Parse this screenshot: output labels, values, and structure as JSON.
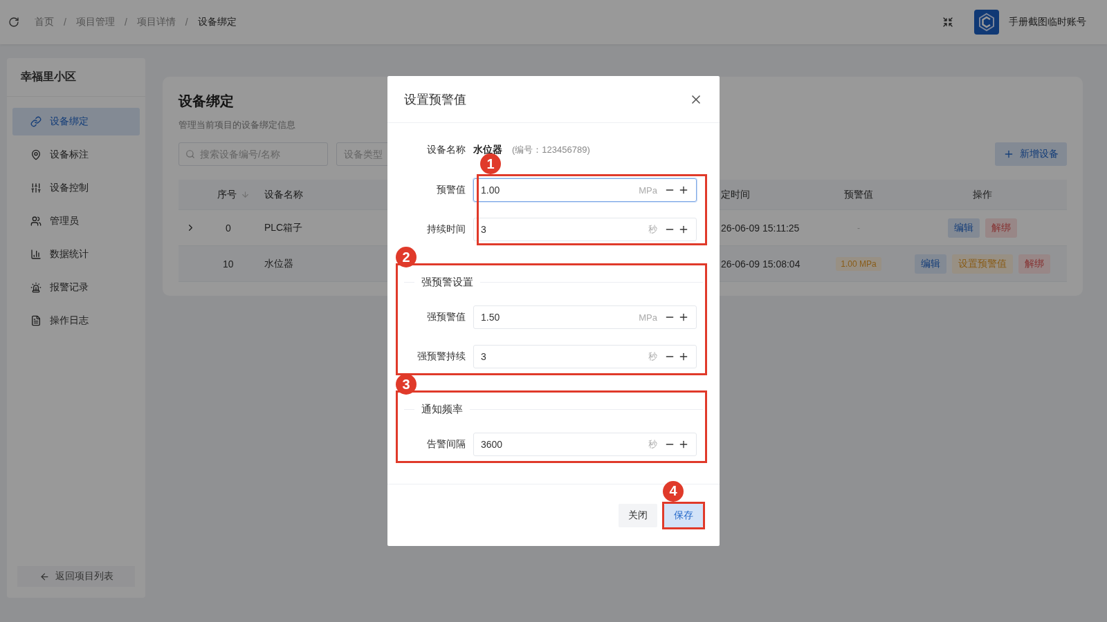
{
  "header": {
    "breadcrumb": [
      {
        "label": "首页",
        "current": false
      },
      {
        "label": "项目管理",
        "current": false
      },
      {
        "label": "项目详情",
        "current": false
      },
      {
        "label": "设备绑定",
        "current": true
      }
    ],
    "separator": "/",
    "user": "手册截图临时账号"
  },
  "sidebar": {
    "title": "幸福里小区",
    "items": [
      {
        "label": "设备绑定",
        "selected": true
      },
      {
        "label": "设备标注",
        "selected": false
      },
      {
        "label": "设备控制",
        "selected": false
      },
      {
        "label": "管理员",
        "selected": false
      },
      {
        "label": "数据统计",
        "selected": false
      },
      {
        "label": "报警记录",
        "selected": false
      },
      {
        "label": "操作日志",
        "selected": false
      }
    ],
    "back_button": "返回项目列表"
  },
  "main": {
    "title": "设备绑定",
    "subtitle": "管理当前项目的设备绑定信息",
    "search": {
      "placeholder": "搜索设备编号/名称"
    },
    "type_filter": {
      "placeholder": "设备类型"
    },
    "add_button": "新增设备",
    "table": {
      "columns": [
        {
          "label": "序号",
          "sortable": true
        },
        {
          "label": "设备名称",
          "sortable": false
        },
        {
          "label": "定时间",
          "sortable": false
        },
        {
          "label": "预警值",
          "sortable": false
        },
        {
          "label": "操作",
          "sortable": false
        }
      ],
      "rows": [
        {
          "expandable": true,
          "hovered": false,
          "index": "0",
          "name": "PLC箱子",
          "time": "26-06-09 15:11:25",
          "warning": {
            "kind": "empty",
            "text": "-"
          },
          "actions": [
            {
              "label": "编辑",
              "kind": "primary"
            },
            {
              "label": "解绑",
              "kind": "danger"
            }
          ]
        },
        {
          "expandable": false,
          "hovered": true,
          "index": "10",
          "name": "水位器",
          "time": "26-06-09 15:08:04",
          "warning": {
            "kind": "tag",
            "text": "1.00 MPa"
          },
          "actions": [
            {
              "label": "编辑",
              "kind": "primary"
            },
            {
              "label": "设置预警值",
              "kind": "warning"
            },
            {
              "label": "解绑",
              "kind": "danger"
            }
          ]
        }
      ]
    }
  },
  "modal": {
    "title": "设置预警值",
    "device": {
      "label": "设备名称",
      "name": "水位器",
      "code": "(编号：123456789)"
    },
    "groups": [
      {
        "callout": "1",
        "fields": [
          {
            "label": "预警值",
            "value": "1.00",
            "unit": "MPa",
            "focused": true
          },
          {
            "label": "持续时间",
            "value": "3",
            "unit": "秒",
            "focused": false
          }
        ]
      },
      {
        "callout": "2",
        "heading": "强预警设置",
        "fields": [
          {
            "label": "强预警值",
            "value": "1.50",
            "unit": "MPa",
            "focused": false
          },
          {
            "label": "强预警持续",
            "value": "3",
            "unit": "秒",
            "focused": false
          }
        ]
      },
      {
        "callout": "3",
        "heading": "通知频率",
        "fields": [
          {
            "label": "告警间隔",
            "value": "3600",
            "unit": "秒",
            "focused": false
          }
        ]
      }
    ],
    "buttons": [
      {
        "label": "关闭",
        "kind": "default"
      },
      {
        "label": "保存",
        "kind": "primary",
        "callout": "4"
      }
    ]
  }
}
